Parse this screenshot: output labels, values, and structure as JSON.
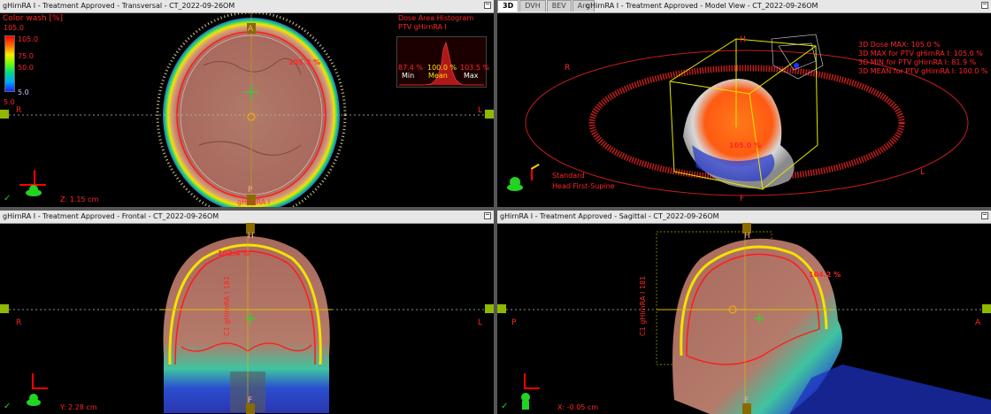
{
  "transversal": {
    "title": "gHirnRA I  -  Treatment Approved - Transversal - CT_2022-09-26OM",
    "colorwash": {
      "label": "Color wash [%]",
      "max_top": "105.0",
      "max_arrow": "105.0",
      "v1": "75.0",
      "v2": "50.0",
      "min_arrow": "5.0",
      "min_bottom": "5.0"
    },
    "dose_max_label": "105.3 %",
    "dah": {
      "title": "Dose Area Histogram",
      "subtitle": "PTV gHirnRA I",
      "min_val": "87.4 %",
      "mean_val": "100.0 %",
      "max_val": "103.5 %",
      "min_lbl": "Min",
      "mean_lbl": "Mean",
      "max_lbl": "Max"
    },
    "orient": {
      "A": "A",
      "P": "P",
      "R": "R",
      "L": "L"
    },
    "zpos": "Z: 1.15 cm",
    "struct_label": "gHirnRA I"
  },
  "model3d": {
    "tabs": [
      "3D",
      "DVH",
      "BEV",
      "Arc"
    ],
    "title": "gHirnRA I  -  Treatment Approved - Model View - CT_2022-09-26OM",
    "stats": [
      "3D Dose MAX: 105.0 %",
      "3D MAX for PTV gHirnRA I: 105.0 %",
      "3D MIN for PTV gHirnRA I: 81.9 %",
      "3D MEAN for PTV gHirnRA I: 100.0 %"
    ],
    "dose_label": "105.0 %",
    "orient": {
      "R": "R",
      "L": "L",
      "H": "H",
      "F": "F"
    },
    "position": [
      "Standard",
      "Head First-Supine"
    ]
  },
  "frontal": {
    "title": "gHirnRA I  -  Treatment Approved - Frontal - CT_2022-09-26OM",
    "dose_max_label": "103.4 %",
    "struct_label": "C1 gHirnRA I 181",
    "orient": {
      "H": "H",
      "F": "F",
      "R": "R",
      "L": "L"
    },
    "ypos": "Y: 2.28 cm"
  },
  "sagittal": {
    "title": "gHirnRA I  -  Treatment Approved - Sagittal - CT_2022-09-26OM",
    "dose_max_label": "104.2 %",
    "struct_label": "C1 gHirnRA I 181",
    "orient": {
      "H": "H",
      "F": "F",
      "P": "P",
      "A": "A"
    },
    "xpos": "X: -0.05 cm"
  },
  "colors": {
    "dose_red": "#ff2626",
    "check": "#1dd41d",
    "titlebar": "#e7e7e7"
  }
}
